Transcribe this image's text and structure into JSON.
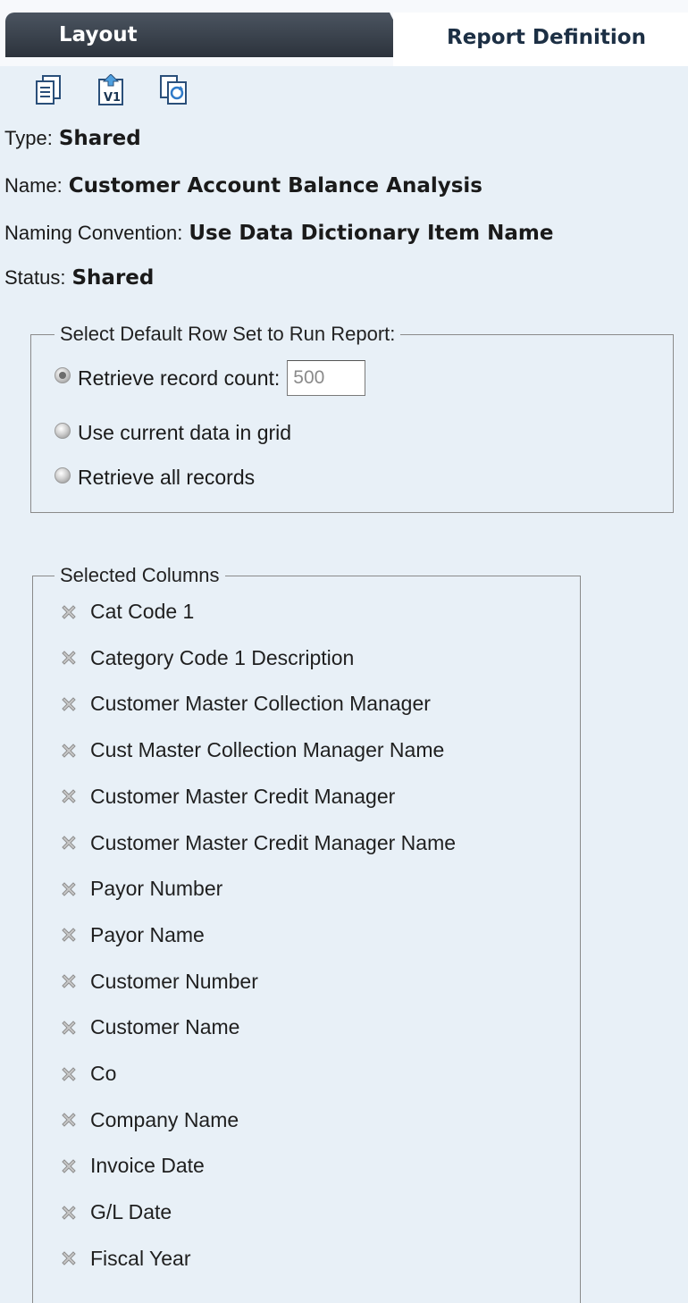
{
  "tabs": {
    "layout": "Layout",
    "report_definition": "Report Definition"
  },
  "toolbar": {
    "icons": [
      "copy-icon",
      "version-icon",
      "refresh-icon"
    ]
  },
  "info": {
    "type_label": "Type:",
    "type_value": "Shared",
    "name_label": "Name:",
    "name_value": "Customer Account Balance Analysis",
    "naming_label": "Naming Convention:",
    "naming_value": "Use Data Dictionary Item Name",
    "status_label": "Status:",
    "status_value": "Shared"
  },
  "row_set": {
    "legend": "Select Default Row Set to Run Report:",
    "options": [
      {
        "label": "Retrieve record count:",
        "checked": true
      },
      {
        "label": "Use current data in grid",
        "checked": false
      },
      {
        "label": "Retrieve all records",
        "checked": false
      }
    ],
    "record_count": "500"
  },
  "selected_columns": {
    "legend": "Selected Columns",
    "items": [
      "Cat Code 1",
      "Category Code 1  Description",
      "Customer Master Collection Manager",
      "Cust Master Collection Manager Name",
      "Customer Master Credit Manager",
      "Customer Master Credit  Manager Name",
      "Payor Number",
      "Payor Name",
      "Customer Number",
      "Customer Name",
      "Co",
      "Company Name",
      "Invoice Date",
      "G/L Date",
      "Fiscal Year"
    ]
  }
}
